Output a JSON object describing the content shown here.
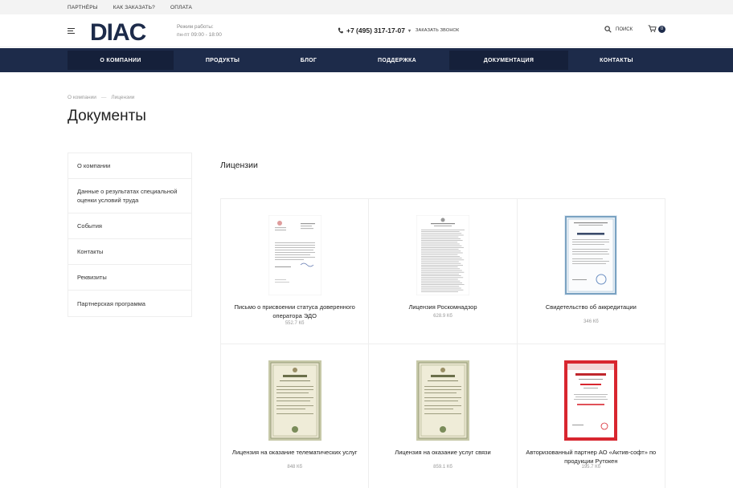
{
  "topbar": {
    "links": [
      "ПАРТНЁРЫ",
      "КАК ЗАКАЗАТЬ?",
      "ОПЛАТА"
    ]
  },
  "header": {
    "logo": "DIAC",
    "worktime_label": "Режим работы:",
    "worktime_value": "пн-пт 09:00 - 18:00",
    "phone": "+7 (495) 317-17-07",
    "callback": "ЗАКАЗАТЬ ЗВОНОК",
    "search": "ПОИСК",
    "cart_count": "0"
  },
  "nav": {
    "items": [
      "О КОМПАНИИ",
      "ПРОДУКТЫ",
      "БЛОГ",
      "ПОДДЕРЖКА",
      "ДОКУМЕНТАЦИЯ",
      "КОНТАКТЫ"
    ]
  },
  "breadcrumb": {
    "items": [
      "О компании",
      "Лицензии"
    ],
    "separator": "—"
  },
  "page": {
    "title": "Документы",
    "section_title": "Лицензии"
  },
  "sidebar": {
    "items": [
      "О компании",
      "Данные о результатах специальной оценки условий труда",
      "События",
      "Контакты",
      "Реквизиты",
      "Партнерская программа"
    ]
  },
  "documents": [
    {
      "name": "Письмо о присвоении статуса доверенного оператора ЭДО",
      "size": "552.7 Кб",
      "thumb": "letter"
    },
    {
      "name": "Лицензия Роскомнадзор",
      "size": "628.9 Кб",
      "thumb": "license-text"
    },
    {
      "name": "Свидетельство об аккредитации",
      "size": "346 Кб",
      "thumb": "certificate-blue"
    },
    {
      "name": "Лицензия на оказание телематических услуг",
      "size": "848 Кб",
      "thumb": "license-green"
    },
    {
      "name": "Лицензия на оказание услуг связи",
      "size": "859.1 Кб",
      "thumb": "license-green"
    },
    {
      "name": "Авторизованный партнер АО «Актив-софт» по продукции Рутокен",
      "size": "195.7 Кб",
      "thumb": "certificate-red"
    }
  ],
  "colors": {
    "brand_navy": "#1d2b4a",
    "nav_active": "#15203a",
    "certificate_red": "#d8262f"
  }
}
